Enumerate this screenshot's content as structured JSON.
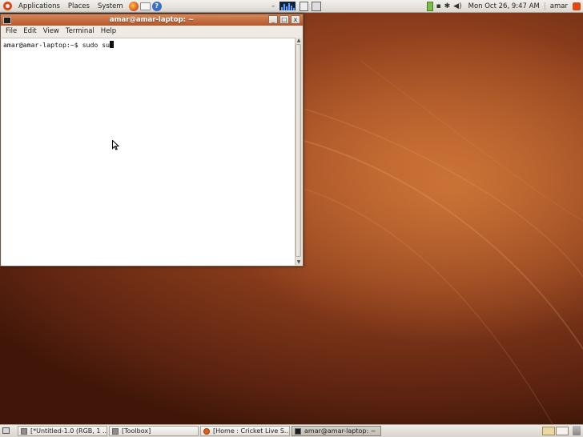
{
  "top_panel": {
    "menus": [
      "Applications",
      "Places",
      "System"
    ],
    "datetime": "Mon Oct 26,  9:47 AM",
    "username": "amar"
  },
  "terminal": {
    "title": "amar@amar-laptop: ~",
    "menus": [
      "File",
      "Edit",
      "View",
      "Terminal",
      "Help"
    ],
    "prompt": "amar@amar-laptop:~$ ",
    "command": "sudo su"
  },
  "taskbar": {
    "tasks": [
      {
        "label": "[*Untitled-1.0 (RGB, 1 ...",
        "active": false
      },
      {
        "label": "[Toolbox]",
        "active": false
      },
      {
        "label": "[Home : Cricket Live S...",
        "active": false
      },
      {
        "label": "amar@amar-laptop: ~",
        "active": true
      }
    ]
  },
  "colors": {
    "title_bar": "#c46a3c",
    "wallpaper": "#8d3e1c",
    "ubuntu_orange": "#dd4814"
  }
}
